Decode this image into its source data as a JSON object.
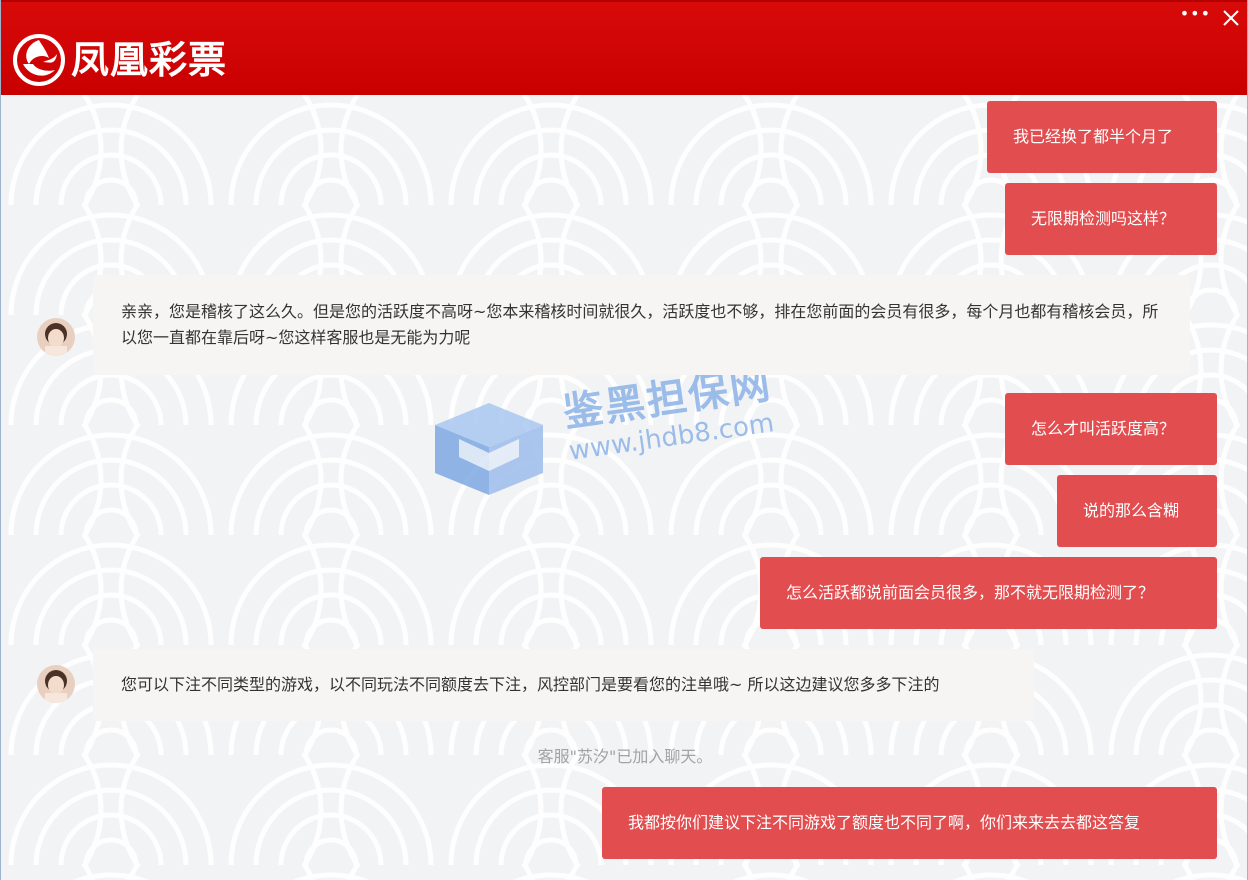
{
  "app": {
    "title": "凤凰彩票",
    "brand_color": "#d40000",
    "controls": {
      "more_label": "•••",
      "close_icon": "close-icon"
    }
  },
  "watermark": {
    "title": "鉴黑担保网",
    "url": "www.jhdb8.com"
  },
  "messages": [
    {
      "side": "out",
      "text": "我已经换了都半个月了"
    },
    {
      "side": "out",
      "text": "无限期检测吗这样？"
    },
    {
      "side": "in",
      "text": "亲亲，您是稽核了这么久。但是您的活跃度不高呀~您本来稽核时间就很久，活跃度也不够，排在您前面的会员有很多，每个月也都有稽核会员，所以您一直都在靠后呀~您这样客服也是无能为力呢"
    },
    {
      "side": "out",
      "text": "怎么才叫活跃度高？"
    },
    {
      "side": "out",
      "text": "说的那么含糊"
    },
    {
      "side": "out",
      "text": "怎么活跃都说前面会员很多，那不就无限期检测了？"
    },
    {
      "side": "in",
      "text": "您可以下注不同类型的游戏，以不同玩法不同额度去下注，风控部门是要看您的注单哦~ 所以这边建议您多多下注的"
    },
    {
      "side": "out",
      "text": "我都按你们建议下注不同游戏了额度也不同了啊，你们来来去去都这答复"
    }
  ],
  "system_note": "客服\"苏汐\"已加入聊天。",
  "colors": {
    "outgoing_bubble": "#e24d4f",
    "incoming_bubble": "#f7f5f4",
    "background": "#f2f3f5"
  }
}
